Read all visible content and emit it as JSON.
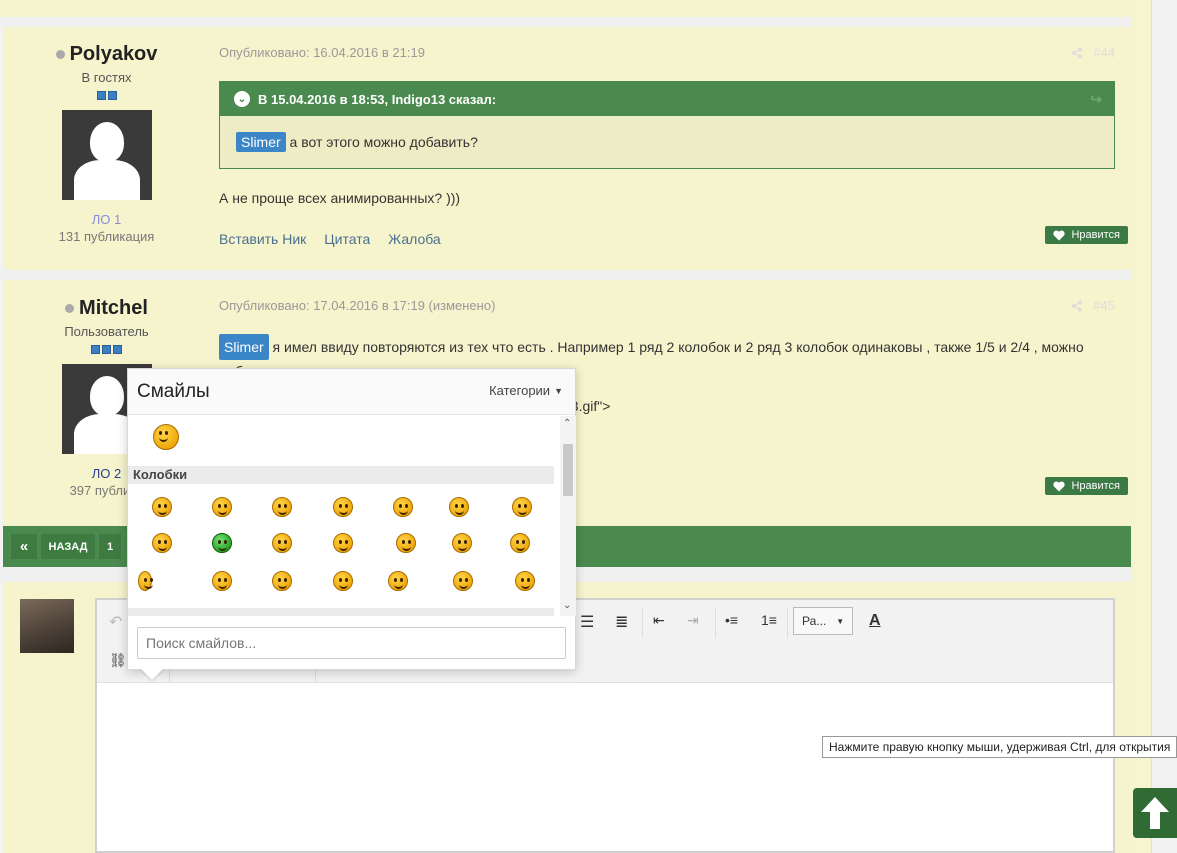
{
  "posts": [
    {
      "author": "Polyakov",
      "group": "В гостях",
      "rank": "ЛО 1",
      "publications": "131 публикация",
      "published": "Опубликовано: 16.04.2016 в 21:19",
      "number": "#44",
      "quote_header": "В 15.04.2016 в 18:53, Indigo13 сказал:",
      "quote_mention": "Slimer",
      "quote_text": " а вот этого можно добавить?",
      "text": "А не проще всех анимированных? )))",
      "actions": [
        "Вставить Ник",
        "Цитата",
        "Жалоба"
      ],
      "like": "Нравится"
    },
    {
      "author": "Mitchel",
      "group": "Пользователь",
      "rank": "ЛО 2",
      "publications": "397 публика",
      "published": "Опубликовано: 17.04.2016 в 17:19 (изменено)",
      "number": "#45",
      "mention": "Slimer",
      "text": " я имел ввиду повторяются из тех что есть . Например 1 ряд 2 колобок и 2 ряд 3 колобок одинаковы , также 1/5 и 2/4 , можно",
      "text2": "добавить этого",
      "text3": "d3.gif\">",
      "like": "Нравится"
    }
  ],
  "pager": {
    "prev": "«",
    "back": "НАЗАД",
    "page": "1"
  },
  "smiley_popup": {
    "title": "Смайлы",
    "categories": "Категории",
    "category_label": "Колобки",
    "search_placeholder": "Поиск смайлов..."
  },
  "editor": {
    "font_select": "Ра..."
  },
  "tooltip": "Нажмите правую кнопку мыши, удерживая Ctrl, для открытия",
  "icons": [
    "share-icon",
    "heart-icon",
    "chevron-down-icon",
    "reply-arrow-icon",
    "up-arrow-icon",
    "link-icon",
    "undo-icon",
    "align-icon",
    "list-icon",
    "font-color-icon"
  ],
  "colors": {
    "accent_green": "#4a8a4e",
    "post_bg": "#f6f4cd",
    "mention_blue": "#3b86c6"
  }
}
